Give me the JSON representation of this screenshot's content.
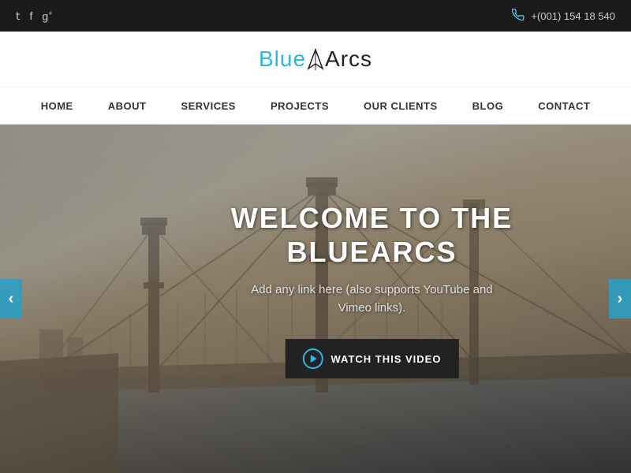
{
  "topbar": {
    "phone": "+(001) 154 18 540",
    "social": [
      {
        "icon": "𝕏",
        "name": "twitter",
        "label": "Twitter"
      },
      {
        "icon": "f",
        "name": "facebook",
        "label": "Facebook"
      },
      {
        "icon": "g+",
        "name": "googleplus",
        "label": "Google Plus"
      }
    ]
  },
  "logo": {
    "part1": "Blue",
    "part2": "Arcs"
  },
  "nav": {
    "items": [
      {
        "label": "HOME",
        "name": "home"
      },
      {
        "label": "ABOUT",
        "name": "about"
      },
      {
        "label": "SERVICES",
        "name": "services"
      },
      {
        "label": "PROJECTS",
        "name": "projects"
      },
      {
        "label": "OUR CLIENTS",
        "name": "our-clients"
      },
      {
        "label": "BLOG",
        "name": "blog"
      },
      {
        "label": "CONTACT",
        "name": "contact"
      }
    ]
  },
  "hero": {
    "title": "WELCOME TO THE\nBLUEARCS",
    "title_line1": "WELCOME TO THE",
    "title_line2": "BLUEARCS",
    "subtitle": "Add any link here (also supports YouTube and\nVimeo links).",
    "cta_label": "WATCH THIS VIDEO",
    "arrow_left": "‹",
    "arrow_right": "›"
  }
}
